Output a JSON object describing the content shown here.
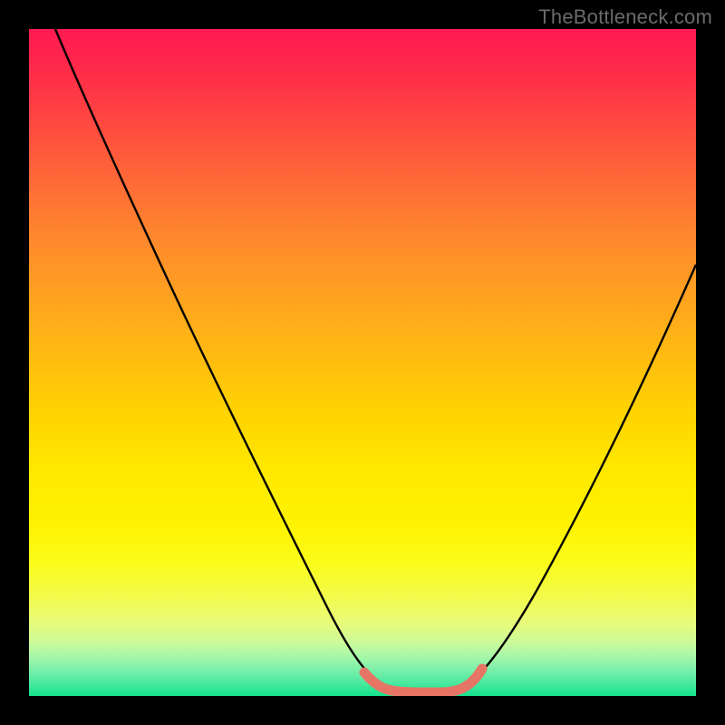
{
  "watermark": {
    "text": "TheBottleneck.com"
  },
  "chart_data": {
    "type": "line",
    "title": "",
    "xlabel": "",
    "ylabel": "",
    "xlim": [
      0,
      100
    ],
    "ylim": [
      0,
      100
    ],
    "grid": false,
    "legend": false,
    "background": {
      "type": "vertical-gradient",
      "meaning": "bottleneck severity (red=high, green=none)",
      "stops": [
        {
          "pos": 0,
          "color": "#ff1a52"
        },
        {
          "pos": 50,
          "color": "#ffd400"
        },
        {
          "pos": 100,
          "color": "#12e28e"
        }
      ]
    },
    "series": [
      {
        "name": "bottleneck-curve",
        "stroke": "#000000",
        "x": [
          4,
          10,
          16,
          22,
          28,
          34,
          40,
          46,
          50,
          54,
          56,
          58,
          60,
          64,
          68,
          72,
          78,
          86,
          94,
          100
        ],
        "y": [
          100,
          90,
          80,
          70,
          59,
          48,
          36,
          24,
          14,
          6,
          2,
          1,
          1,
          2,
          6,
          14,
          26,
          44,
          60,
          72
        ]
      },
      {
        "name": "optimal-band",
        "stroke": "#e77566",
        "stroke_width_px": 10,
        "x": [
          50,
          52,
          54,
          56,
          58,
          60,
          62,
          64
        ],
        "y": [
          4,
          1.5,
          0.8,
          0.6,
          0.6,
          0.8,
          1.5,
          4
        ]
      }
    ]
  }
}
